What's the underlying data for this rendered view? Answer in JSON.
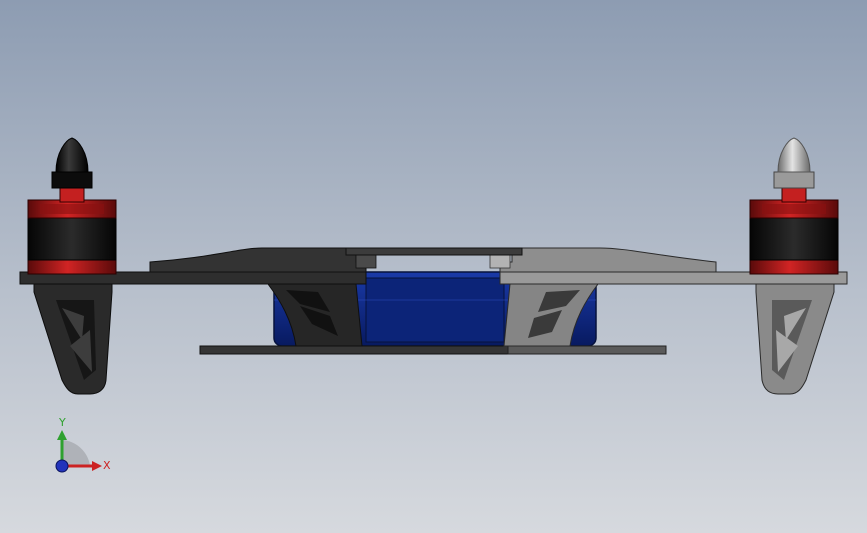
{
  "triad": {
    "y_label": "Y",
    "x_label": "X",
    "y_color": "#2fa12f",
    "x_color": "#cc2222",
    "z_color": "#2233bb"
  },
  "model": {
    "left_half_color": "#2f2f2f",
    "right_half_color": "#8c8c8c",
    "battery_color": "#0e2a8a",
    "motor_stator_color": "#141414",
    "motor_band_color": "#b81c1c",
    "left_prop_nut_color": "#111111",
    "right_prop_nut_color": "#b8b8b8",
    "icons": [
      "left-motor-icon",
      "right-motor-icon",
      "left-landing-leg-icon",
      "right-landing-leg-icon",
      "battery-icon",
      "frame-arm-icon",
      "triad-icon"
    ]
  }
}
